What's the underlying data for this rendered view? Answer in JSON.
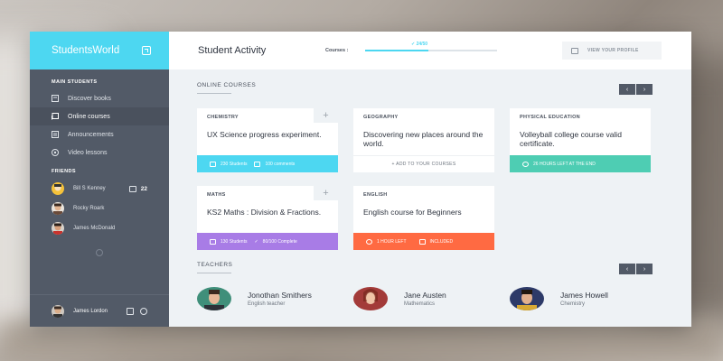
{
  "brand": "StudentsWorld",
  "sidebar": {
    "main_title": "MAIN STUDENTS",
    "items": [
      {
        "label": "Discover books",
        "icon": "book-icon"
      },
      {
        "label": "Online courses",
        "icon": "screen-icon"
      },
      {
        "label": "Announcements",
        "icon": "list-icon"
      },
      {
        "label": "Video lessons",
        "icon": "play-icon"
      }
    ],
    "friends_title": "FRIENDS",
    "friends": [
      {
        "name": "Bill S Kenney",
        "badge": "22"
      },
      {
        "name": "Rocky Roark"
      },
      {
        "name": "James McDonald"
      }
    ],
    "current_user": "James Lordon"
  },
  "header": {
    "title": "Student Activity",
    "courses_label": "Courses :",
    "progress_text": "✓ 24/50",
    "progress_fraction": 0.48,
    "profile_button": "VIEW YOUR PROFILE"
  },
  "online_courses": {
    "title": "ONLINE COURSES",
    "prev": "‹",
    "next": "›",
    "cards": [
      {
        "category": "CHEMISTRY",
        "title": "UX Science progress experiment.",
        "foot1": "230 Students",
        "foot2": "100 comments",
        "color": "#4dd7f1"
      },
      {
        "category": "GEOGRAPHY",
        "title": "Discovering new places around the world.",
        "foot1": "+ ADD TO YOUR COURSES"
      },
      {
        "category": "PHYSICAL EDUCATION",
        "title": "Volleyball college course valid certificate.",
        "foot1": "26 HOURS LEFT AT THE END",
        "color": "#4ecdb3"
      },
      {
        "category": "MATHS",
        "title": "KS2 Maths : Division & Fractions.",
        "foot1": "130 Students",
        "foot2": "80/100 Complete",
        "color": "#a87ce6"
      },
      {
        "category": "ENGLISH",
        "title": "English course for Beginners",
        "foot1": "1 HOUR LEFT",
        "foot2": "INCLUDED",
        "color": "#ff6a42"
      }
    ]
  },
  "teachers": {
    "title": "TEACHERS",
    "prev": "‹",
    "next": "›",
    "list": [
      {
        "name": "Jonothan Smithers",
        "role": "English teacher"
      },
      {
        "name": "Jane Austen",
        "role": "Mathematics"
      },
      {
        "name": "James Howell",
        "role": "Chemistry"
      }
    ]
  }
}
